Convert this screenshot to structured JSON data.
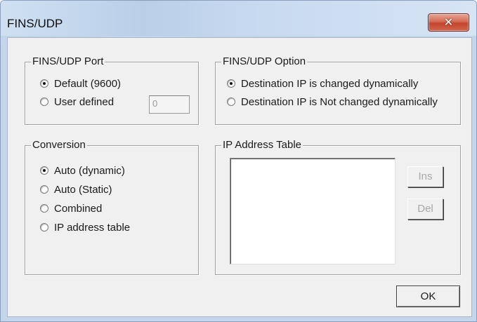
{
  "window": {
    "title": "FINS/UDP",
    "close_glyph": "✕"
  },
  "port_group": {
    "legend": "FINS/UDP Port",
    "options": [
      {
        "label": "Default (9600)",
        "checked": true
      },
      {
        "label": "User defined",
        "checked": false
      }
    ],
    "user_defined_value": "0"
  },
  "option_group": {
    "legend": "FINS/UDP Option",
    "options": [
      {
        "label": "Destination IP is changed dynamically",
        "checked": true
      },
      {
        "label": "Destination IP is Not changed dynamically",
        "checked": false
      }
    ]
  },
  "conversion_group": {
    "legend": "Conversion",
    "options": [
      {
        "label": "Auto (dynamic)",
        "checked": true
      },
      {
        "label": "Auto (Static)",
        "checked": false
      },
      {
        "label": "Combined",
        "checked": false
      },
      {
        "label": "IP address table",
        "checked": false
      }
    ]
  },
  "ip_table_group": {
    "legend": "IP Address Table",
    "ins_label": "Ins",
    "del_label": "Del"
  },
  "ok_label": "OK"
}
